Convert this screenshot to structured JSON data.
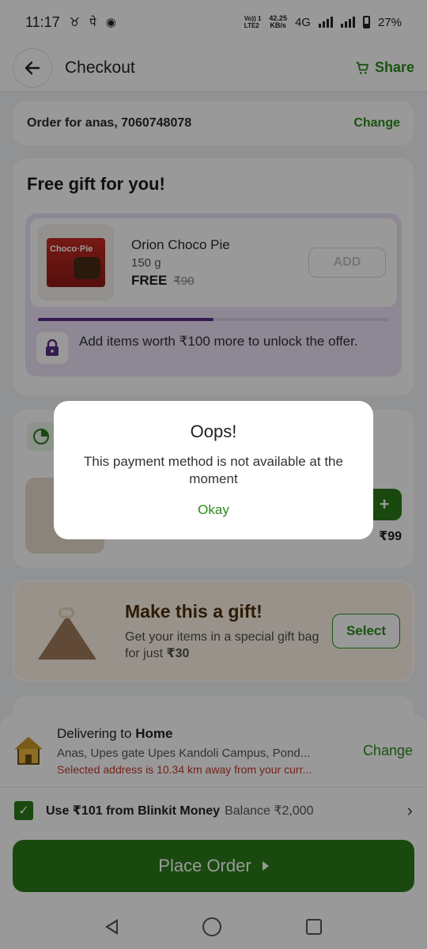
{
  "status_bar": {
    "time": "11:17",
    "volte_top": "Vo)) 1",
    "volte_bottom": "LTE2",
    "speed_value": "42.25",
    "speed_unit": "KB/s",
    "network": "4G",
    "battery": "27%"
  },
  "header": {
    "title": "Checkout",
    "share_label": "Share"
  },
  "order_for": {
    "text": "Order for anas, 7060748078",
    "change_label": "Change"
  },
  "free_gift": {
    "title": "Free gift for you!",
    "product_name": "Orion Choco Pie",
    "quantity": "150 g",
    "price": "FREE",
    "mrp": "₹90",
    "add_label": "ADD",
    "progress_fraction": 0.5,
    "unlock_text": "Add items worth ₹100 more to unlock the offer."
  },
  "cart_item": {
    "price": "₹99",
    "stepper_plus": "+"
  },
  "gift_wrap": {
    "title": "Make this a gift!",
    "desc_prefix": "Get your items in a special gift bag for just ",
    "desc_price": "₹30",
    "select_label": "Select"
  },
  "delivery": {
    "label_prefix": "Delivering to ",
    "label_place": "Home",
    "address": "Anas, Upes gate Upes Kandoli Campus, Pond...",
    "warning": "Selected address is 10.34 km away from your curr...",
    "change_label": "Change"
  },
  "blinkit_money": {
    "use_text": "Use ₹101 from Blinkit Money",
    "balance_text": "Balance ₹2,000"
  },
  "place_order": {
    "label": "Place Order"
  },
  "dialog": {
    "title": "Oops!",
    "message": "This payment method is not available at the moment",
    "okay_label": "Okay"
  },
  "colors": {
    "brand_green": "#2a7a18",
    "link_green": "#2a8c1a",
    "warning_red": "#c0392b",
    "gift_purple": "#ece3f6"
  }
}
